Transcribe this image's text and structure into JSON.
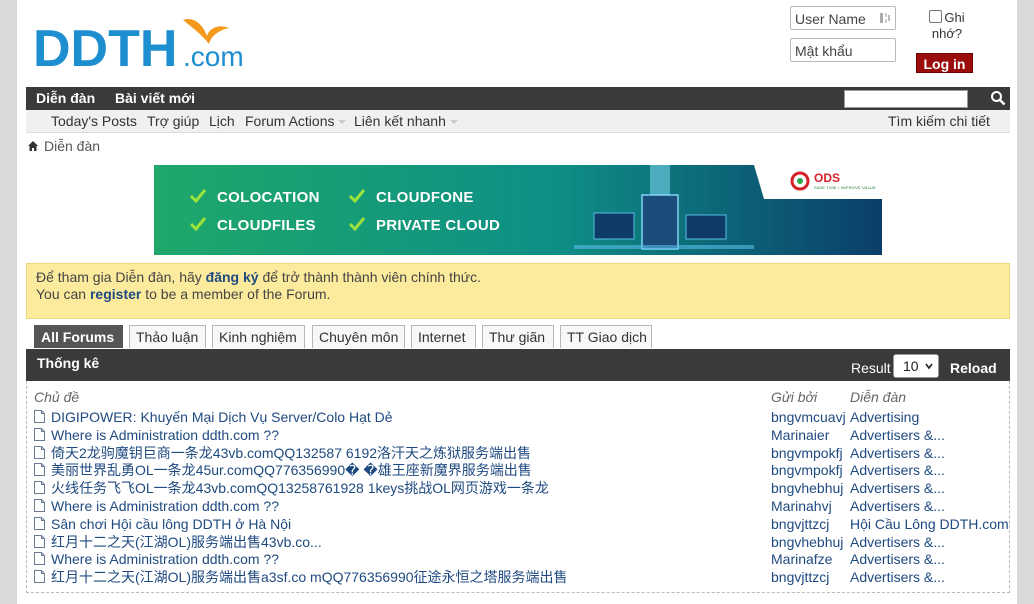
{
  "logo": {
    "main": "DDTH",
    "suffix": ".com"
  },
  "login": {
    "username_placeholder": "User Name",
    "password_placeholder": "Mật khẩu",
    "remember_label": "Ghi nhớ?",
    "button_label": "Log in"
  },
  "navbar": {
    "tabs": [
      "Diễn đàn",
      "Bài viết mới"
    ],
    "search_value": ""
  },
  "subnav": {
    "items": [
      "Today's Posts",
      "Trợ giúp",
      "Lịch",
      "Forum Actions",
      "Liên kết nhanh"
    ],
    "advanced_search": "Tìm kiếm chi tiết"
  },
  "breadcrumb": {
    "label": "Diễn đàn"
  },
  "banner": {
    "items": [
      "COLOCATION",
      "CLOUDFONE",
      "CLOUDFILES",
      "PRIVATE CLOUD"
    ],
    "brand": "ODS",
    "brand_tagline": "SAVE TIME • IMPROVE VALUE"
  },
  "notice": {
    "vi_prefix": "Để tham gia Diễn đàn, hãy ",
    "vi_link": "đăng ký",
    "vi_suffix": " để trở thành thành viên chính thức.",
    "en_prefix": "You can ",
    "en_link": "register",
    "en_suffix": " to be a member of the Forum."
  },
  "forum_tabs": [
    "All Forums",
    "Thảo luận",
    "Kinh nghiệm",
    "Chuyên môn",
    "Internet",
    "Thư giãn",
    "TT Giao dịch"
  ],
  "stats": {
    "title": "Thống kê",
    "result_label": "Result",
    "result_value": "10",
    "reload_label": "Reload",
    "columns": [
      "Chủ đề",
      "Gửi bởi",
      "Diễn đàn"
    ],
    "rows": [
      {
        "title": "DIGIPOWER: Khuyến Mại Dịch Vụ Server/Colo Hạt Dẻ",
        "user": "bngvmcuavj",
        "forum": "Advertising"
      },
      {
        "title": "Where is Administration ddth.com ??",
        "user": "Marinaier",
        "forum": "Advertisers &..."
      },
      {
        "title": "倚天2龙驹魔钥巨商一条龙43vb.comQQ132587 6192洛汗天之炼狱服务端出售",
        "user": "bngvmpokfj",
        "forum": "Advertisers &..."
      },
      {
        "title": "美丽世界乱勇OL一条龙45ur.comQQ776356990� �雄王座新魔界服务端出售",
        "user": "bngvmpokfj",
        "forum": "Advertisers &..."
      },
      {
        "title": "火线任务飞飞OL一条龙43vb.comQQ13258761928 1keys挑战OL网页游戏一条龙",
        "user": "bngvhebhuj",
        "forum": "Advertisers &..."
      },
      {
        "title": "Where is Administration ddth.com ??",
        "user": "Marinahvj",
        "forum": "Advertisers &..."
      },
      {
        "title": "Sân chơi Hội cầu lông DDTH ở Hà Nội",
        "user": "bngvjttzcj",
        "forum": "Hội Cầu Lông DDTH.com"
      },
      {
        "title": "红月十二之天(江湖OL)服务端出售43vb.co...",
        "user": "bngvhebhuj",
        "forum": "Advertisers &..."
      },
      {
        "title": "Where is Administration ddth.com ??",
        "user": "Marinafze",
        "forum": "Advertisers &..."
      },
      {
        "title": "红月十二之天(江湖OL)服务端出售a3sf.co mQQ776356990征途永恒之塔服务端出售",
        "user": "bngvjttzcj",
        "forum": "Advertisers &..."
      }
    ]
  },
  "colors": {
    "brand_blue": "#1d8fd0",
    "brand_orange": "#f39a1c",
    "navbar": "#3a3a3a",
    "login_button": "#9b0c0c",
    "notice_bg": "#fdeb9d",
    "link": "#1f4a80"
  }
}
